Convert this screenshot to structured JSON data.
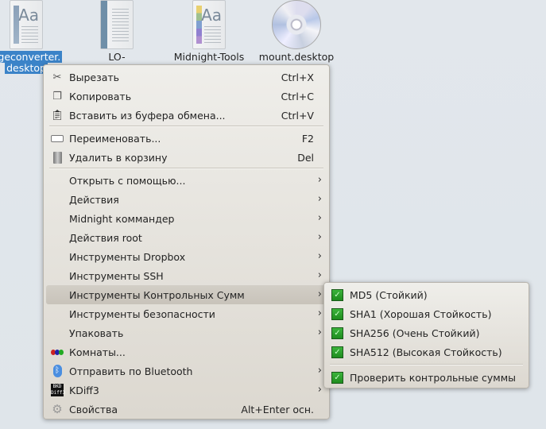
{
  "desktop": {
    "icons": [
      {
        "label_line1": "ageconverter.",
        "label_line2": "desktop",
        "selected": true
      },
      {
        "label_line1": "LO-"
      },
      {
        "label_line1": "Midnight-Tools"
      },
      {
        "label_line1": "mount.desktop"
      }
    ]
  },
  "menu": {
    "items": [
      {
        "label": "Вырезать",
        "shortcut": "Ctrl+X",
        "icon": "scissors-icon"
      },
      {
        "label": "Копировать",
        "shortcut": "Ctrl+C",
        "icon": "copy-icon"
      },
      {
        "label": "Вставить из буфера обмена...",
        "shortcut": "Ctrl+V",
        "icon": "paste-icon"
      },
      {
        "label": "Переименовать...",
        "shortcut": "F2",
        "icon": "rename-icon"
      },
      {
        "label": "Удалить в корзину",
        "shortcut": "Del",
        "icon": "trash-icon"
      },
      {
        "label": "Открыть с помощью..."
      },
      {
        "label": "Действия"
      },
      {
        "label": "Midnight коммандер"
      },
      {
        "label": "Действия root"
      },
      {
        "label": "Инструменты Dropbox"
      },
      {
        "label": "Инструменты SSH"
      },
      {
        "label": "Инструменты Контрольных Сумм"
      },
      {
        "label": "Инструменты безопасности"
      },
      {
        "label": "Упаковать"
      },
      {
        "label": "Комнаты...",
        "icon": "activities-icon"
      },
      {
        "label": "Отправить по Bluetooth",
        "icon": "bluetooth-icon"
      },
      {
        "label": "KDiff3",
        "icon": "kdiff3-icon"
      },
      {
        "label": "Свойства",
        "shortcut": "Alt+Enter осн.",
        "icon": "gear-icon"
      }
    ]
  },
  "submenu": {
    "items": [
      {
        "label": "MD5 (Стойкий)"
      },
      {
        "label": "SHA1 (Хорошая Стойкость)"
      },
      {
        "label": "SHA256 (Очень Стойкий)"
      },
      {
        "label": "SHA512 (Высокая Стойкость)"
      },
      {
        "label": "Проверить контрольные суммы"
      }
    ]
  },
  "colors": {
    "highlight": "#c8c3ba",
    "check": "#2aa02a",
    "selection": "#3b83c8"
  }
}
